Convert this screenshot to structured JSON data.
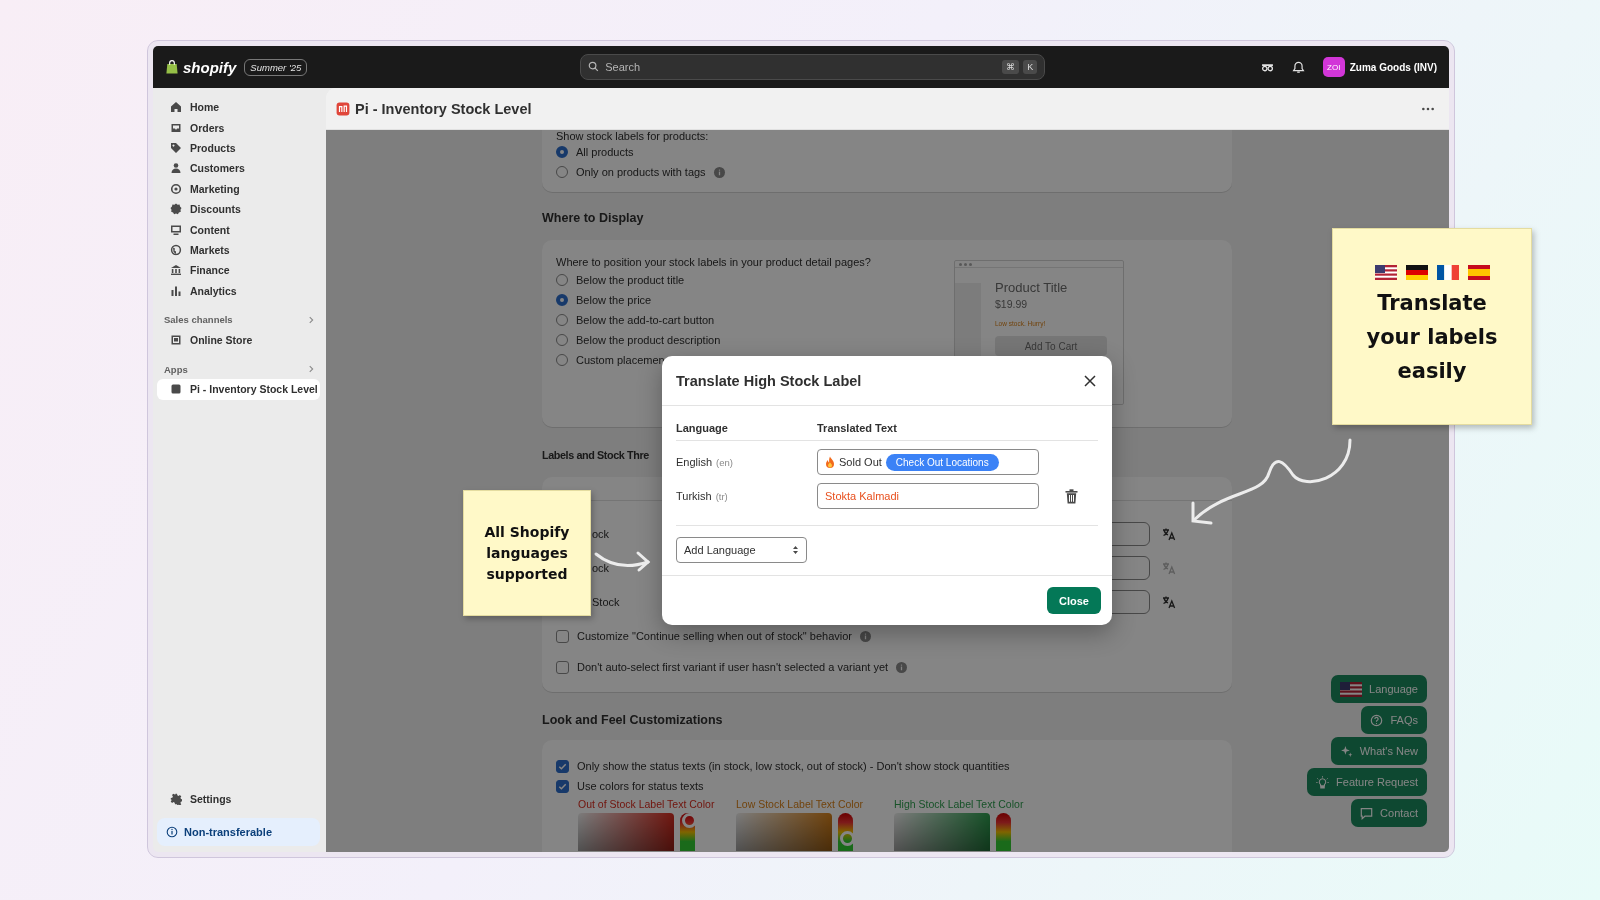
{
  "topbar": {
    "brand": "shopify",
    "edition": "Summer '25",
    "search": {
      "placeholder": "Search"
    },
    "shortcut": [
      "⌘",
      "K"
    ],
    "store": {
      "avatar": "ZOI",
      "name": "Zuma Goods (INV)"
    }
  },
  "sidebar": {
    "items": [
      {
        "label": "Home",
        "selected": false
      },
      {
        "label": "Orders",
        "selected": false
      },
      {
        "label": "Products",
        "selected": false
      },
      {
        "label": "Customers",
        "selected": false
      },
      {
        "label": "Marketing",
        "selected": false
      },
      {
        "label": "Discounts",
        "selected": false
      },
      {
        "label": "Content",
        "selected": false
      },
      {
        "label": "Markets",
        "selected": false
      },
      {
        "label": "Finance",
        "selected": false
      },
      {
        "label": "Analytics",
        "selected": false
      }
    ],
    "sections": [
      {
        "title": "Sales channels",
        "items": [
          {
            "label": "Online Store",
            "selected": false
          }
        ]
      },
      {
        "title": "Apps",
        "items": [
          {
            "label": "Pi - Inventory Stock Level",
            "selected": true
          }
        ]
      }
    ],
    "footer_items": [
      {
        "label": "Settings",
        "selected": false
      }
    ],
    "notice": "Non-transferable"
  },
  "page": {
    "title": "Pi - Inventory Stock Level"
  },
  "product_scope": {
    "prompt": "Show stock labels for products:",
    "options": [
      {
        "label": "All products",
        "selected": true,
        "info": false
      },
      {
        "label": "Only on products with tags",
        "selected": false,
        "info": true
      }
    ]
  },
  "where_to_display": {
    "heading": "Where to Display",
    "prompt": "Where to position your stock labels in your product detail pages?",
    "options": [
      {
        "label": "Below the product title",
        "selected": false
      },
      {
        "label": "Below the price",
        "selected": true
      },
      {
        "label": "Below the add-to-cart button",
        "selected": false
      },
      {
        "label": "Below the product description",
        "selected": false
      },
      {
        "label": "Custom placemen",
        "selected": false
      }
    ],
    "preview": {
      "title": "Product Title",
      "price": "$19.99",
      "stock_text": "Low stock. Hurry!",
      "button": "Add To Cart"
    }
  },
  "labels": {
    "heading": "Labels and Stock Thre",
    "rows": [
      {
        "label": "ock",
        "disabled": false
      },
      {
        "label": "ock",
        "disabled": true
      },
      {
        "label": "Stock",
        "disabled": false
      }
    ],
    "options": [
      {
        "label": "Customize \"Continue selling when out of stock\" behavior",
        "checked": false,
        "info": true
      },
      {
        "label": "Don't auto-select first variant if user hasn't selected a variant yet",
        "checked": false,
        "info": true
      }
    ]
  },
  "look_and_feel": {
    "heading": "Look and Feel Customizations",
    "options": [
      {
        "label": "Only show the status texts (in stock, low stock, out of stock) - Don't show stock quantities",
        "checked": true
      },
      {
        "label": "Use colors for status texts",
        "checked": true
      }
    ],
    "colors": [
      {
        "label": "Out of Stock Label Text Color",
        "kind": "out_of_stock",
        "level": 0.8
      },
      {
        "label": "Low Stock Label Text Color",
        "kind": "low_stock",
        "level": 0.32
      },
      {
        "label": "High Stock Label Text Color",
        "kind": "high_stock"
      }
    ]
  },
  "modal": {
    "title": "Translate High Stock Label",
    "columns": [
      "Language",
      "Translated Text"
    ],
    "rows": [
      {
        "language": "English",
        "code": "(en)",
        "kind": "rich",
        "text": "Sold Out",
        "chip": "Check Out Locations",
        "color": "#303030",
        "deletable": false
      },
      {
        "language": "Turkish",
        "code": "(tr)",
        "kind": "plain",
        "text": "Stokta Kalmadi",
        "color": "#e8501e",
        "deletable": true
      }
    ],
    "add_language": "Add Language",
    "close": "Close"
  },
  "help_buttons": [
    {
      "label": "Language"
    },
    {
      "label": "FAQs"
    },
    {
      "label": "What's New"
    },
    {
      "label": "Feature Request"
    },
    {
      "label": "Contact"
    }
  ],
  "notes": [
    {
      "text": "All Shopify languages supported"
    },
    {
      "text": "Translate your labels easily"
    }
  ]
}
